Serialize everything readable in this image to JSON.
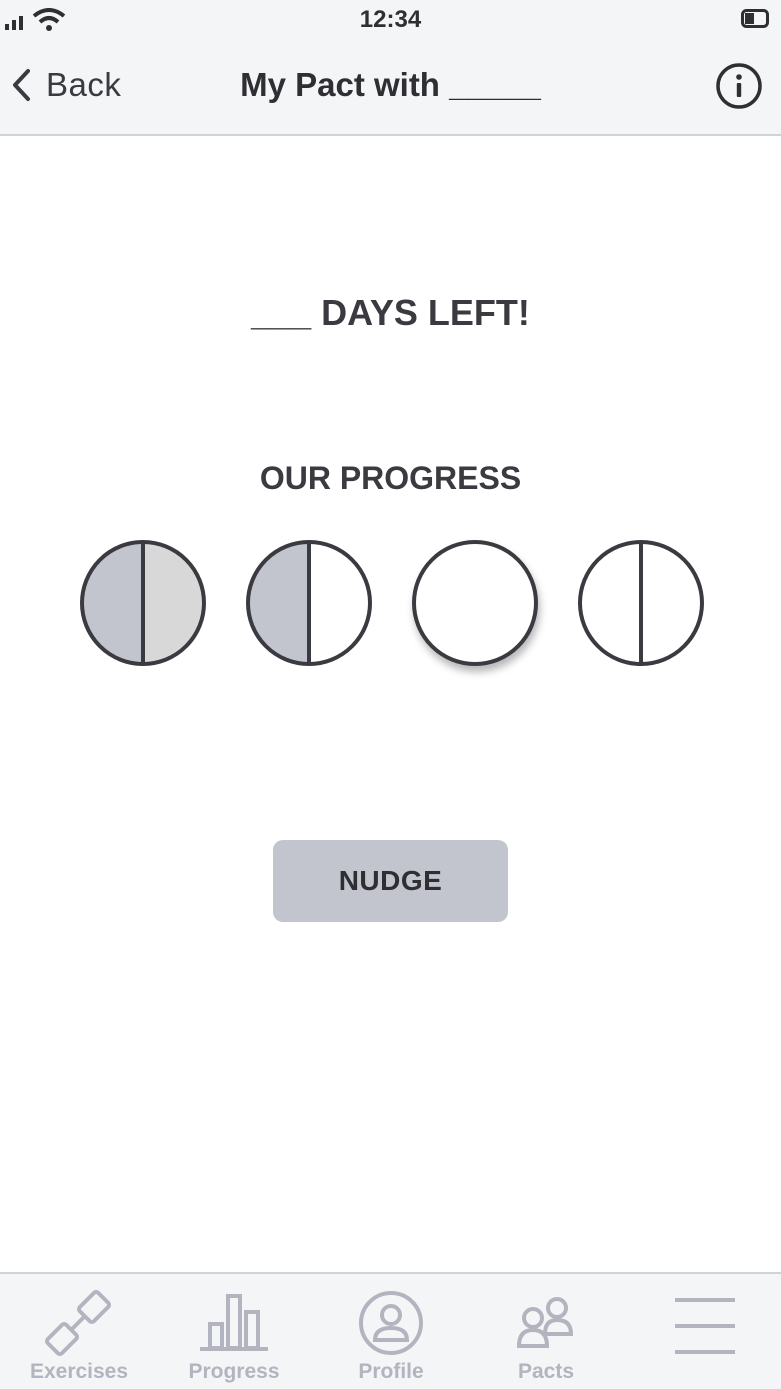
{
  "status_bar": {
    "time": "12:34"
  },
  "nav": {
    "back_label": "Back",
    "title": "My Pact with _____"
  },
  "main": {
    "days_left": "___ DAYS LEFT!",
    "progress_title": "OUR PROGRESS",
    "progress_circles": [
      {
        "state": "both-halves-filled",
        "left_color": "#c2c5ce",
        "right_color": "#d8d8d8"
      },
      {
        "state": "left-half-filled",
        "left_color": "#c2c5ce",
        "right_color": "#ffffff"
      },
      {
        "state": "selected-empty"
      },
      {
        "state": "empty"
      }
    ],
    "nudge_label": "NUDGE"
  },
  "tab_bar": {
    "items": [
      {
        "label": "Exercises",
        "icon": "dumbbell-icon"
      },
      {
        "label": "Progress",
        "icon": "bar-chart-icon"
      },
      {
        "label": "Profile",
        "icon": "person-icon"
      },
      {
        "label": "Pacts",
        "icon": "people-icon"
      },
      {
        "label": "",
        "icon": "menu-icon"
      }
    ]
  },
  "colors": {
    "accent": "#c2c5ce",
    "text": "#3a3a40",
    "tab_inactive": "#b2b5bf",
    "bar_bg": "#f4f5f7"
  }
}
